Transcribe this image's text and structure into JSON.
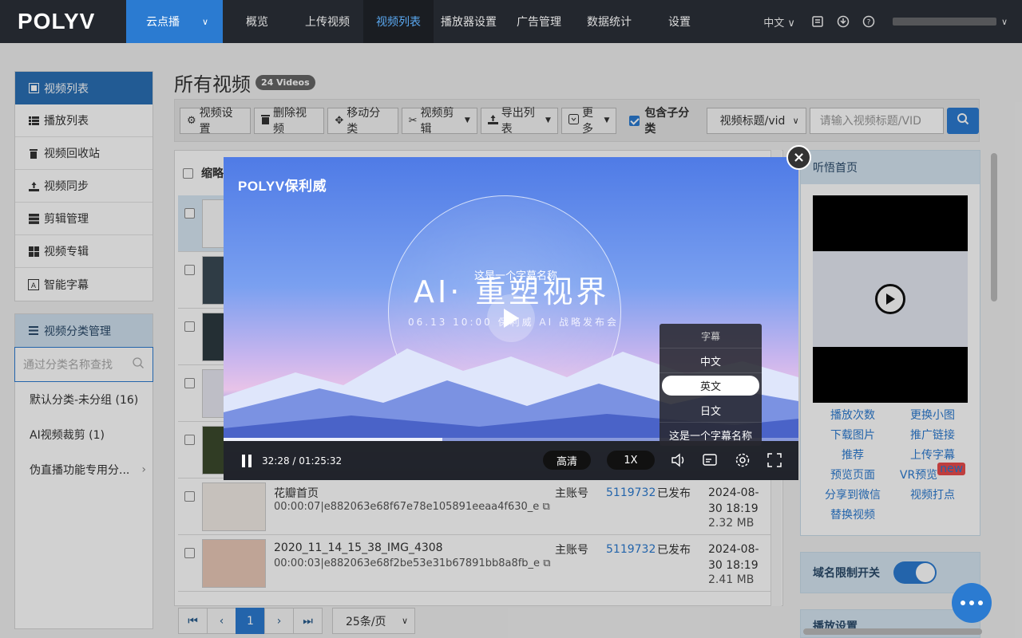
{
  "nav": {
    "logo": "POLYV",
    "product": "云点播",
    "items": [
      "概览",
      "上传视频",
      "视频列表",
      "播放器设置",
      "广告管理",
      "数据统计",
      "设置"
    ],
    "lang": "中文"
  },
  "sidebar": {
    "items": [
      "视频列表",
      "播放列表",
      "视频回收站",
      "视频同步",
      "剪辑管理",
      "视频专辑",
      "智能字幕"
    ],
    "cat_title": "视频分类管理",
    "cat_search_placeholder": "通过分类名称查找",
    "categories": [
      "默认分类-未分组 (16)",
      "AI视频裁剪 (1)",
      "伪直播功能专用分..."
    ]
  },
  "main": {
    "title": "所有视频",
    "count_badge": "24 Videos",
    "toolbar": {
      "video_settings": "视频设置",
      "delete_video": "删除视频",
      "move_category": "移动分类",
      "video_clip": "视频剪辑",
      "export_list": "导出列表",
      "more": "更多",
      "include_sub": "包含子分类",
      "search_type": "视频标题/vid",
      "search_placeholder": "请输入视频标题/VID"
    },
    "table_header": "缩略",
    "rows": [
      {
        "title": "花瓣首页",
        "sub": "00:00:07|e882063e68f67e78e105891eeaa4f630_e",
        "account": "主账号",
        "id": "5119732",
        "status": "已发布",
        "date": "2024-08-30 18:19",
        "size": "2.32 MB"
      },
      {
        "title": "2020_11_14_15_38_IMG_4308",
        "sub": "00:00:03|e882063e68f2be53e31b67891bb8a8fb_e",
        "account": "主账号",
        "id": "5119732",
        "status": "已发布",
        "date": "2024-08-30 18:19",
        "size": "2.41 MB"
      }
    ]
  },
  "pager": {
    "first": "⏮",
    "prev": "‹",
    "current": "1",
    "next": "›",
    "last": "⏭",
    "page_size": "25条/页"
  },
  "rightpanel": {
    "head": "听悟首页",
    "links": [
      "播放次数",
      "更换小图",
      "下载图片",
      "推广链接",
      "推荐",
      "上传字幕",
      "预览页面",
      "VR预览",
      "分享到微信",
      "视频打点",
      "替换视频"
    ],
    "new_tag": "new",
    "domain_limit": "域名限制开关",
    "domain_limit_on": 1,
    "play_settings": "播放设置"
  },
  "player": {
    "brand": "POLYV保利威",
    "headline": "AI· 重塑视界",
    "subline": "06.13 10:00  保利威  AI 战略发布会",
    "caption": "这是一个字幕名称",
    "time": "32:28 / 01:25:32",
    "progress": 0.38,
    "quality": "高清",
    "speed": "1X",
    "subtitle_menu": {
      "title": "字幕",
      "options": [
        "中文",
        "英文",
        "日文",
        "这是一个字幕名称"
      ],
      "selected": "英文"
    }
  },
  "colors": {
    "accent": "#2b7bd1",
    "nav_bg": "#23272e"
  }
}
